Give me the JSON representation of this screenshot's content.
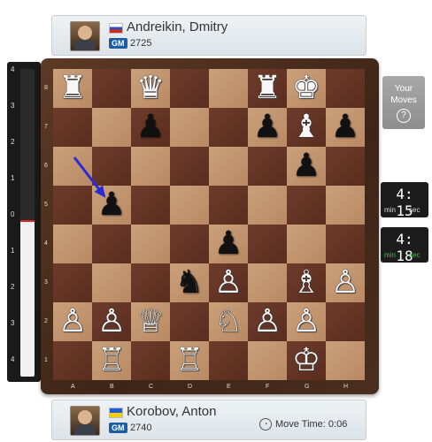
{
  "top_player": {
    "name": "Andreikin, Dmitry",
    "title": "GM",
    "rating": "2725",
    "flag": "russia-flag"
  },
  "bottom_player": {
    "name": "Korobov, Anton",
    "title": "GM",
    "rating": "2740",
    "flag": "ukraine-flag",
    "move_time": "Move Time: 0:06"
  },
  "your_moves": {
    "line1": "Your",
    "line2": "Moves",
    "help": "?"
  },
  "clocks": {
    "top": {
      "time": "4: 15",
      "min_label": "min",
      "sec_label": "sec"
    },
    "bottom": {
      "time": "4: 18",
      "min_label": "min",
      "sec_label": "sec"
    }
  },
  "eval_bar": {
    "labels": [
      "4",
      "3",
      "2",
      "1",
      "0",
      "1",
      "2",
      "3",
      "4"
    ],
    "value": 0.05
  },
  "board": {
    "files": [
      "A",
      "B",
      "C",
      "D",
      "E",
      "F",
      "G",
      "H"
    ],
    "ranks": [
      "8",
      "7",
      "6",
      "5",
      "4",
      "3",
      "2",
      "1"
    ],
    "pieces": [
      {
        "sq": "a8",
        "p": "♜",
        "c": "w"
      },
      {
        "sq": "c8",
        "p": "♛",
        "c": "w"
      },
      {
        "sq": "f8",
        "p": "♜",
        "c": "w"
      },
      {
        "sq": "g8",
        "p": "♚",
        "c": "w"
      },
      {
        "sq": "c7",
        "p": "♟",
        "c": "b"
      },
      {
        "sq": "f7",
        "p": "♟",
        "c": "b"
      },
      {
        "sq": "g7",
        "p": "♝",
        "c": "w"
      },
      {
        "sq": "h7",
        "p": "♟",
        "c": "b"
      },
      {
        "sq": "g6",
        "p": "♟",
        "c": "b"
      },
      {
        "sq": "b5",
        "p": "♟",
        "c": "b"
      },
      {
        "sq": "e4",
        "p": "♟",
        "c": "b"
      },
      {
        "sq": "d3",
        "p": "♞",
        "c": "b"
      },
      {
        "sq": "e3",
        "p": "♙",
        "c": "w"
      },
      {
        "sq": "g3",
        "p": "♗",
        "c": "w"
      },
      {
        "sq": "h3",
        "p": "♙",
        "c": "w"
      },
      {
        "sq": "a2",
        "p": "♙",
        "c": "w"
      },
      {
        "sq": "b2",
        "p": "♙",
        "c": "w"
      },
      {
        "sq": "c2",
        "p": "♕",
        "c": "w"
      },
      {
        "sq": "e2",
        "p": "♘",
        "c": "w"
      },
      {
        "sq": "f2",
        "p": "♙",
        "c": "w"
      },
      {
        "sq": "g2",
        "p": "♙",
        "c": "w"
      },
      {
        "sq": "b1",
        "p": "♖",
        "c": "w"
      },
      {
        "sq": "d1",
        "p": "♖",
        "c": "w"
      },
      {
        "sq": "g1",
        "p": "♔",
        "c": "w"
      }
    ],
    "arrow": {
      "from": "a6",
      "to": "b5",
      "color": "#2b2bd6"
    }
  }
}
